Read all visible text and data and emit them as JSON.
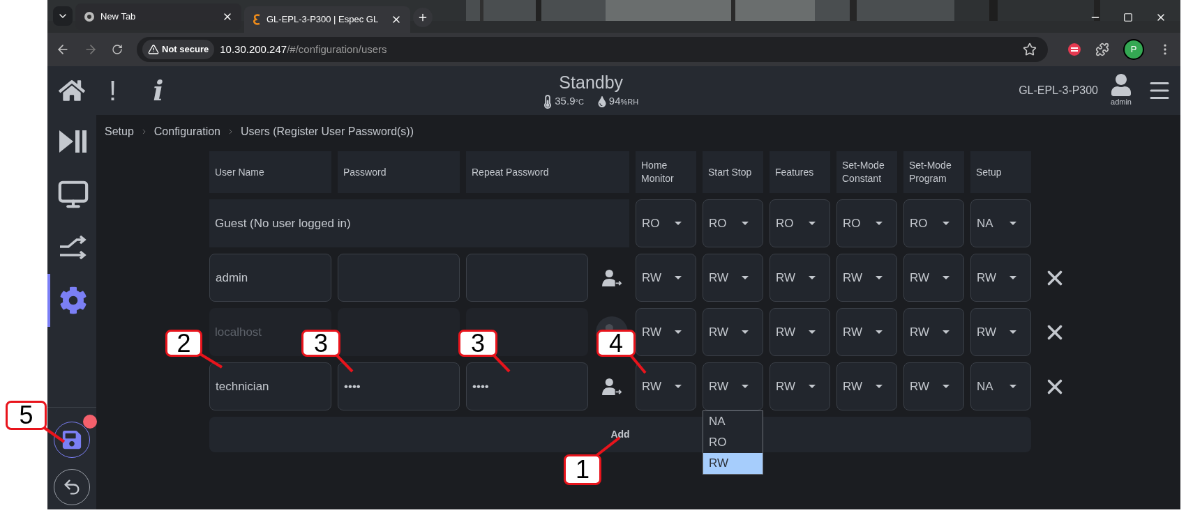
{
  "browser": {
    "tabs": [
      {
        "title": "New Tab",
        "selected": false
      },
      {
        "title": "GL-EPL-3-P300 | Espec GL",
        "selected": true
      }
    ],
    "security": "Not secure",
    "url_host": "10.30.200.247",
    "url_path": "/#/configuration/users",
    "profile": "P"
  },
  "header": {
    "alert_symbol": "!",
    "info_symbol": "i",
    "status": "Standby",
    "temperature": "35.9",
    "temperature_unit": "°C",
    "humidity": "94",
    "humidity_unit": "%RH",
    "device": "GL-EPL-3-P300",
    "user": "admin"
  },
  "sidebar": {
    "items": [
      {
        "kind": "run",
        "selected": false
      },
      {
        "kind": "monitor",
        "selected": false
      },
      {
        "kind": "transfer",
        "selected": false
      },
      {
        "kind": "settings",
        "selected": true
      }
    ],
    "save_unsaved": true
  },
  "breadcrumb": [
    "Setup",
    "Configuration",
    "Users (Register User Password(s))"
  ],
  "table": {
    "columns": [
      "User Name",
      "Password",
      "Repeat Password",
      "Home Monitor",
      "Start Stop",
      "Features",
      "Set-Mode Constant",
      "Set-Mode Program",
      "Setup"
    ],
    "rows": [
      {
        "kind": "guest",
        "user_name": "Guest (No user logged in)",
        "permissions": [
          {
            "value": "RO"
          },
          {
            "value": "RO"
          },
          {
            "value": "RO"
          },
          {
            "value": "RO"
          },
          {
            "value": "RO"
          },
          {
            "value": "NA"
          }
        ]
      },
      {
        "kind": "user",
        "user_name": "admin",
        "disabled": false,
        "permissions": [
          {
            "value": "RW"
          },
          {
            "value": "RW"
          },
          {
            "value": "RW"
          },
          {
            "value": "RW"
          },
          {
            "value": "RW"
          },
          {
            "value": "RW"
          }
        ]
      },
      {
        "kind": "user",
        "user_name": "localhost",
        "disabled": true,
        "permissions": [
          {
            "value": "RW"
          },
          {
            "value": "RW"
          },
          {
            "value": "RW"
          },
          {
            "value": "RW"
          },
          {
            "value": "RW"
          },
          {
            "value": "RW"
          }
        ]
      },
      {
        "kind": "user",
        "user_name": "technician",
        "password": "••••",
        "repeat_password": "••••",
        "disabled": false,
        "permissions": [
          {
            "value": "RW"
          },
          {
            "value": "RW",
            "menu": [
              {
                "label": "NA",
                "selected": false
              },
              {
                "label": "RO",
                "selected": false
              },
              {
                "label": "RW",
                "selected": true
              }
            ]
          },
          {
            "value": "RW"
          },
          {
            "value": "RW"
          },
          {
            "value": "RW"
          },
          {
            "value": "NA"
          }
        ]
      }
    ],
    "add_label": "Add"
  },
  "callouts": [
    "2",
    "3",
    "3",
    "4",
    "5",
    "1"
  ]
}
